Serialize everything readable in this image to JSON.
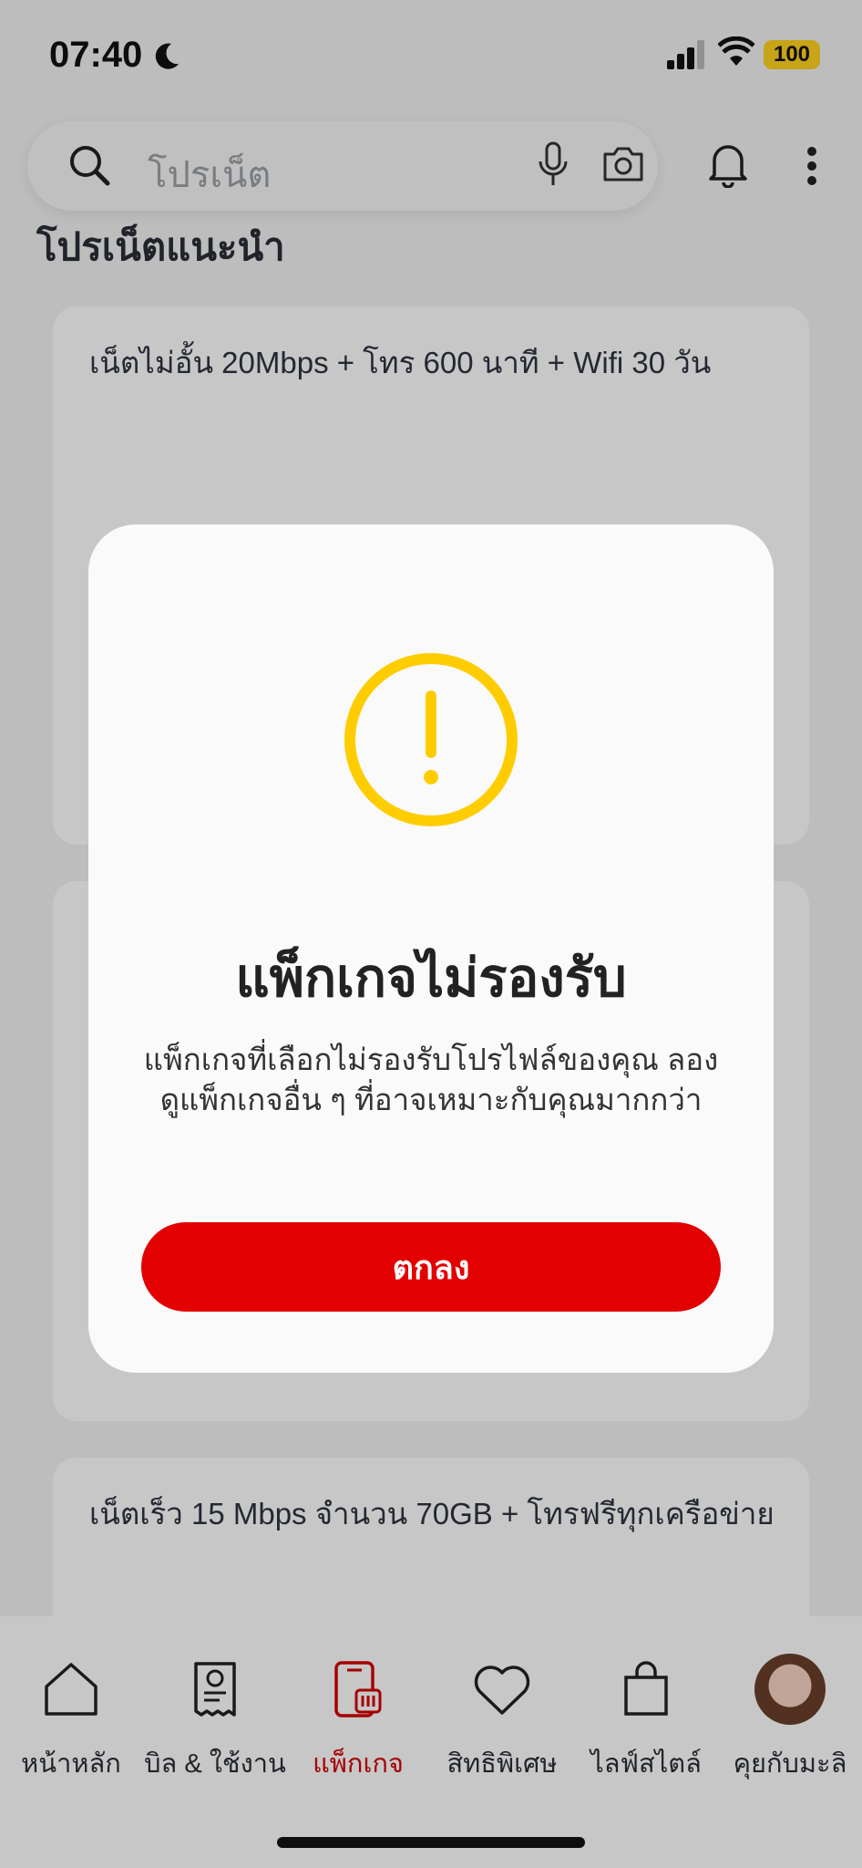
{
  "status_bar": {
    "time": "07:40",
    "battery": "100"
  },
  "search": {
    "placeholder": "โปรเน็ต"
  },
  "section": {
    "title": "โปรเน็ตแนะนำ"
  },
  "cards": [
    {
      "title": "เน็ตไม่อั้น 20Mbps + โทร 600 นาที + Wifi 30 วัน"
    },
    {
      "title": ""
    },
    {
      "title": "เน็ตเร็ว 15 Mbps จำนวน 70GB  + โทรฟรีทุกเครือข่าย"
    }
  ],
  "nav": [
    {
      "label": "หน้าหลัก",
      "icon": "home-icon"
    },
    {
      "label": "บิล & ใช้งาน",
      "icon": "bill-icon"
    },
    {
      "label": "แพ็กเกจ",
      "icon": "package-icon",
      "active": true
    },
    {
      "label": "สิทธิพิเศษ",
      "icon": "heart-icon"
    },
    {
      "label": "ไลฟ์สไตล์",
      "icon": "shopping-bag-icon"
    },
    {
      "label": "คุยกับมะลิ",
      "icon": "avatar"
    }
  ],
  "modal": {
    "title": "แพ็กเกจไม่รองรับ",
    "message": "แพ็กเกจที่เลือกไม่รองรับโปรไฟล์ของคุณ ลองดูแพ็กเกจอื่น ๆ ที่อาจเหมาะกับคุณมากกว่า",
    "button": "ตกลง",
    "icon": "warning-icon"
  },
  "colors": {
    "accent": "#e30000",
    "warning": "#ffcc00"
  }
}
